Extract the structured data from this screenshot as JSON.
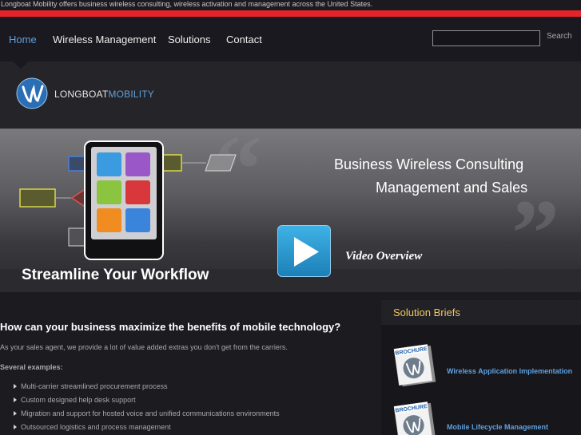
{
  "tagline": "Longboat Mobility offers business wireless consulting, wireless activation and management across the United States.",
  "nav": {
    "items": [
      {
        "label": "Home",
        "active": true
      },
      {
        "label": "Wireless Management",
        "active": false
      },
      {
        "label": "Solutions",
        "active": false
      },
      {
        "label": "Contact",
        "active": false
      }
    ],
    "search_value": "",
    "search_label": "Search"
  },
  "logo": {
    "part1": "LONGBOAT",
    "part2": "MOBILITY"
  },
  "hero": {
    "headline_line1": "Business Wireless Consulting",
    "headline_line2": "Management and Sales",
    "tagline": "Streamline Your Workflow",
    "video_label": "Video Overview"
  },
  "content": {
    "heading": "How can your business maximize the benefits of mobile technology?",
    "intro": "As your sales agent, we provide a lot of value added extras you don't get from the carriers.",
    "examples_label": "Several examples:",
    "bullets": [
      "Multi-carrier streamlined procurement process",
      "Custom designed help desk support",
      "Migration and support for hosted voice and unified communications environments",
      "Outsourced logistics and process management"
    ]
  },
  "sidebar": {
    "title": "Solution Briefs",
    "brochure_label": "BROCHURE",
    "briefs": [
      "Wireless Application Implementation",
      "Mobile Lifecycle Management"
    ]
  },
  "colors": {
    "accent_red": "#e4232a",
    "link_blue": "#5fa0e0",
    "sidebar_title": "#f0c860"
  }
}
